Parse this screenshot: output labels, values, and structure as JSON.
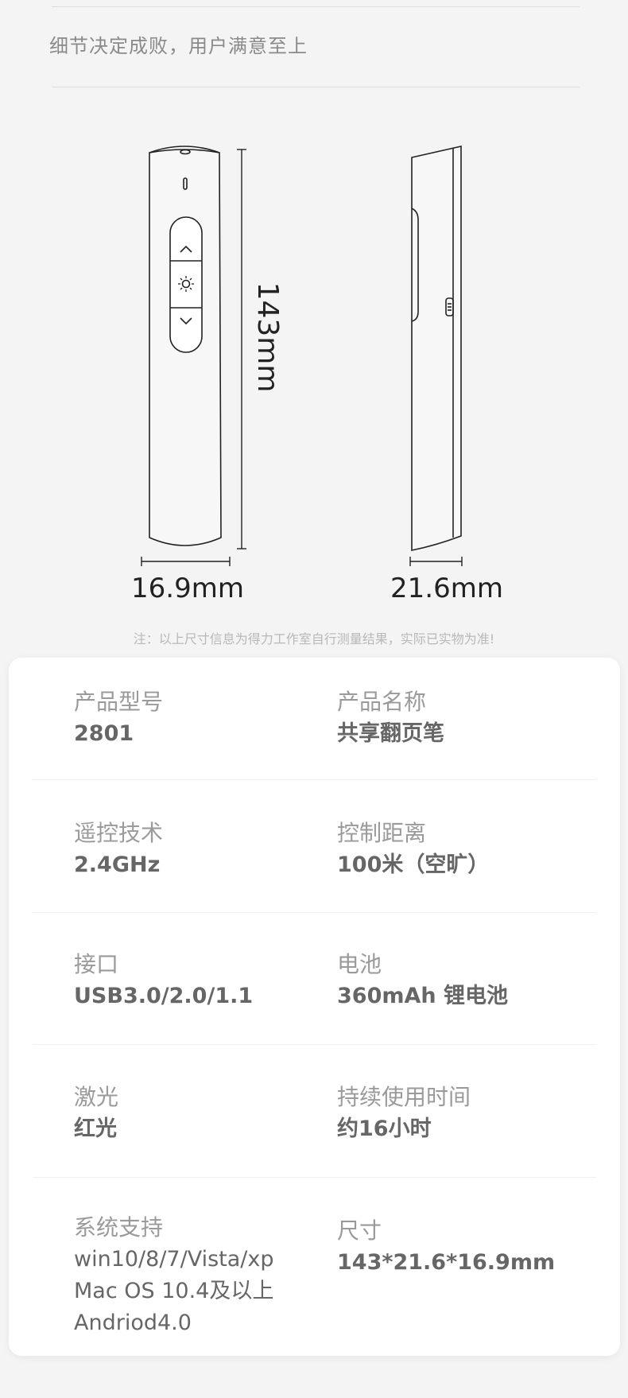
{
  "slogan": "细节决定成败，用户满意至上",
  "diagram": {
    "height_label": "143mm",
    "front_width_label": "16.9mm",
    "side_width_label": "21.6mm"
  },
  "note": "注：以上尺寸信息为得力工作室自行测量结果，实际已实物为准!",
  "specs": [
    {
      "label": "产品型号",
      "value": "2801"
    },
    {
      "label": "产品名称",
      "value": "共享翻页笔"
    },
    {
      "label": "遥控技术",
      "value": "2.4GHz"
    },
    {
      "label": "控制距离",
      "value": "100米（空旷）"
    },
    {
      "label": "接口",
      "value": "USB3.0/2.0/1.1"
    },
    {
      "label": "电池",
      "value": "360mAh 锂电池"
    },
    {
      "label": "激光",
      "value": "红光"
    },
    {
      "label": "持续使用时间",
      "value": "约16小时"
    },
    {
      "label": "系统支持",
      "value_lines": [
        "win10/8/7/Vista/xp",
        "Mac OS 10.4及以上",
        "Andriod4.0"
      ]
    },
    {
      "label": "尺寸",
      "value": "143*21.6*16.9mm"
    }
  ]
}
